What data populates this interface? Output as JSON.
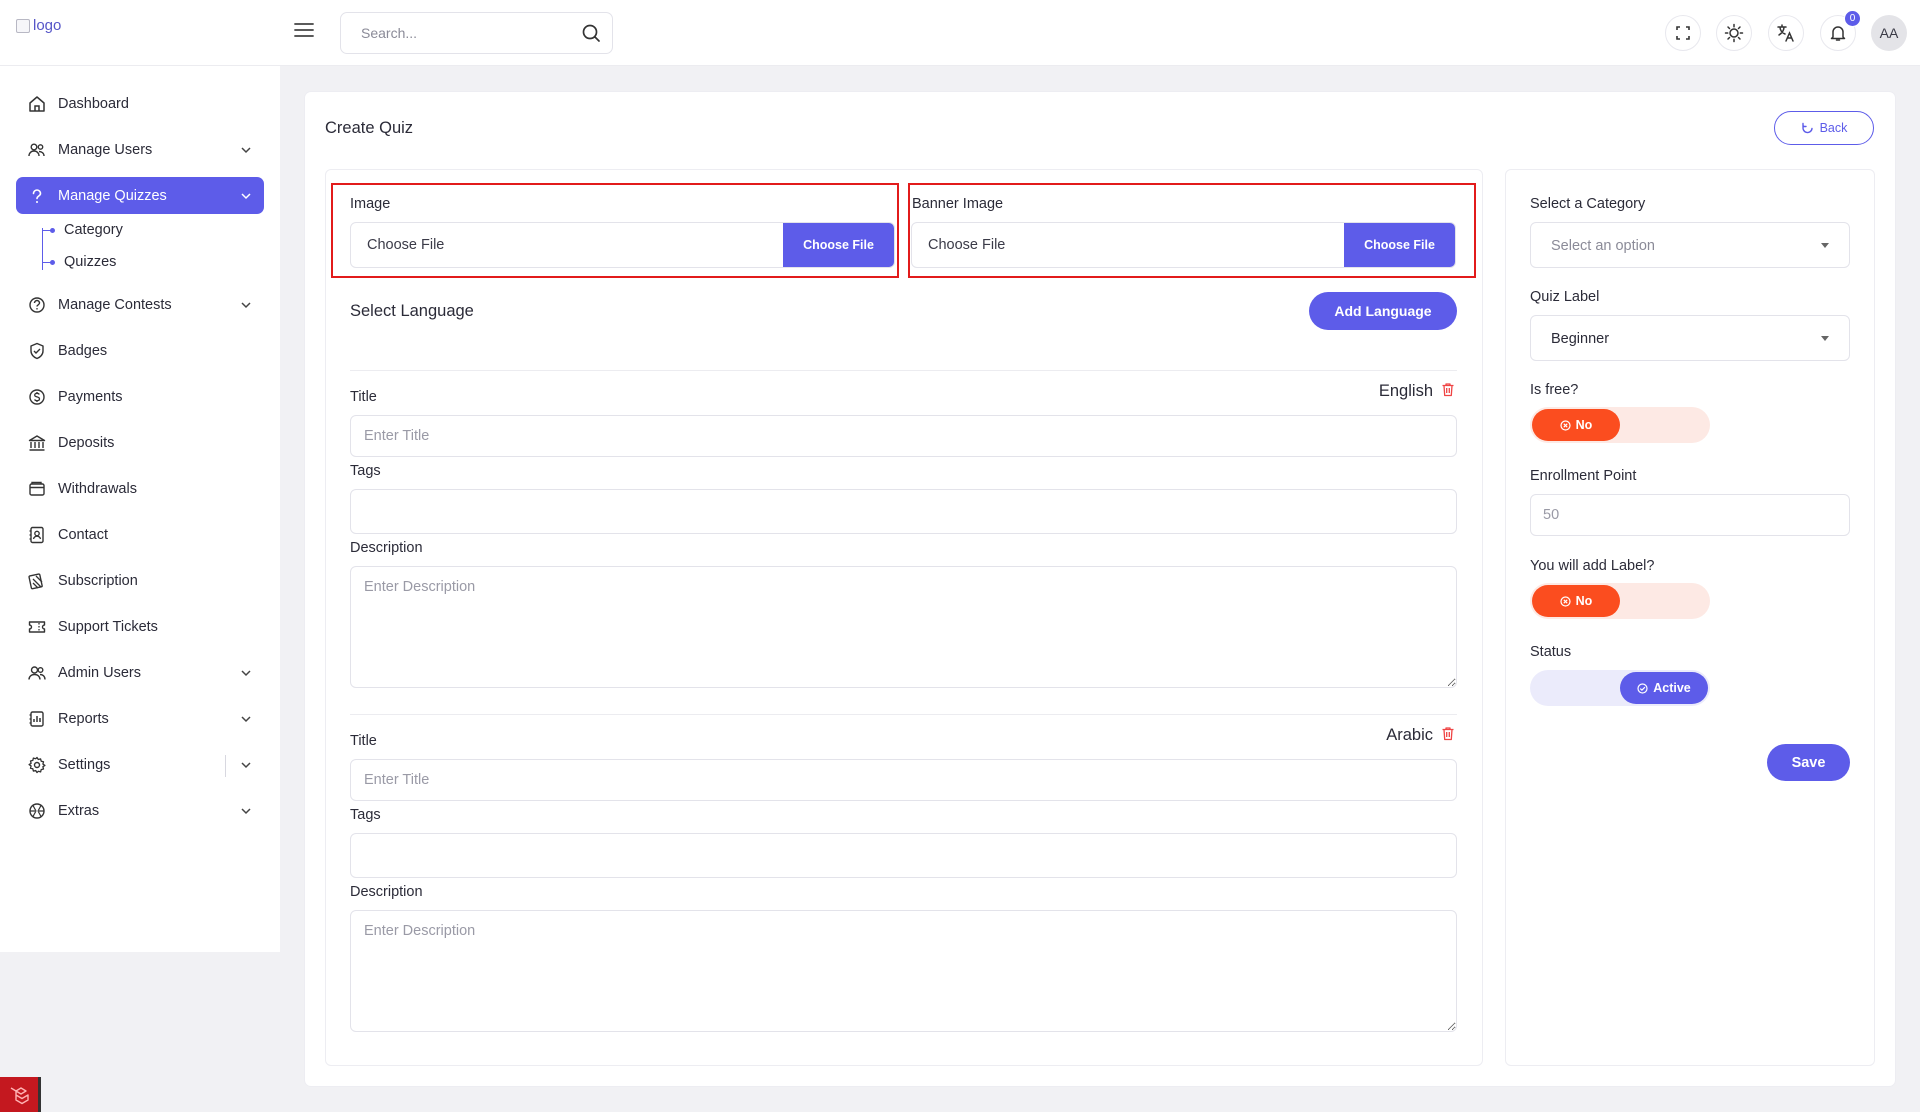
{
  "header": {
    "logo_alt": "logo",
    "search_placeholder": "Search...",
    "notification_count": "0",
    "avatar_initials": "AA"
  },
  "sidebar": {
    "items": [
      {
        "label": "Dashboard",
        "icon": "home-icon"
      },
      {
        "label": "Manage Users",
        "icon": "users-icon",
        "expandable": true
      },
      {
        "label": "Manage Quizzes",
        "icon": "question-icon",
        "expandable": true,
        "active": true
      },
      {
        "label": "Manage Contests",
        "icon": "contest-icon",
        "expandable": true
      },
      {
        "label": "Badges",
        "icon": "badge-icon"
      },
      {
        "label": "Payments",
        "icon": "dollar-icon"
      },
      {
        "label": "Deposits",
        "icon": "bank-icon"
      },
      {
        "label": "Withdrawals",
        "icon": "wallet-icon"
      },
      {
        "label": "Contact",
        "icon": "contact-icon"
      },
      {
        "label": "Subscription",
        "icon": "subscription-icon"
      },
      {
        "label": "Support Tickets",
        "icon": "ticket-icon"
      },
      {
        "label": "Admin Users",
        "icon": "admin-users-icon",
        "expandable": true
      },
      {
        "label": "Reports",
        "icon": "reports-icon",
        "expandable": true
      },
      {
        "label": "Settings",
        "icon": "gear-icon",
        "expandable": true
      },
      {
        "label": "Extras",
        "icon": "extras-icon",
        "expandable": true
      }
    ],
    "quiz_submenu": [
      "Category",
      "Quizzes"
    ]
  },
  "page": {
    "title": "Create Quiz",
    "back_label": "Back"
  },
  "uploads": {
    "image_label": "Image",
    "banner_label": "Banner Image",
    "file_text": "Choose File",
    "file_button": "Choose File"
  },
  "languages": {
    "section_title": "Select Language",
    "add_button": "Add Language",
    "title_label": "Title",
    "title_placeholder": "Enter Title",
    "tags_label": "Tags",
    "description_label": "Description",
    "description_placeholder": "Enter Description",
    "entries": [
      {
        "name": "English"
      },
      {
        "name": "Arabic"
      }
    ]
  },
  "settings": {
    "category_label": "Select a Category",
    "category_placeholder": "Select an option",
    "quiz_label_label": "Quiz Label",
    "quiz_label_value": "Beginner",
    "is_free_label": "Is free?",
    "is_free_value": "No",
    "enrollment_label": "Enrollment Point",
    "enrollment_placeholder": "50",
    "add_label_label": "You will add Label?",
    "add_label_value": "No",
    "status_label": "Status",
    "status_value": "Active",
    "save_label": "Save"
  },
  "colors": {
    "primary": "#5d5ce9",
    "danger": "#fb4d1f",
    "highlight": "#e21b1b"
  }
}
